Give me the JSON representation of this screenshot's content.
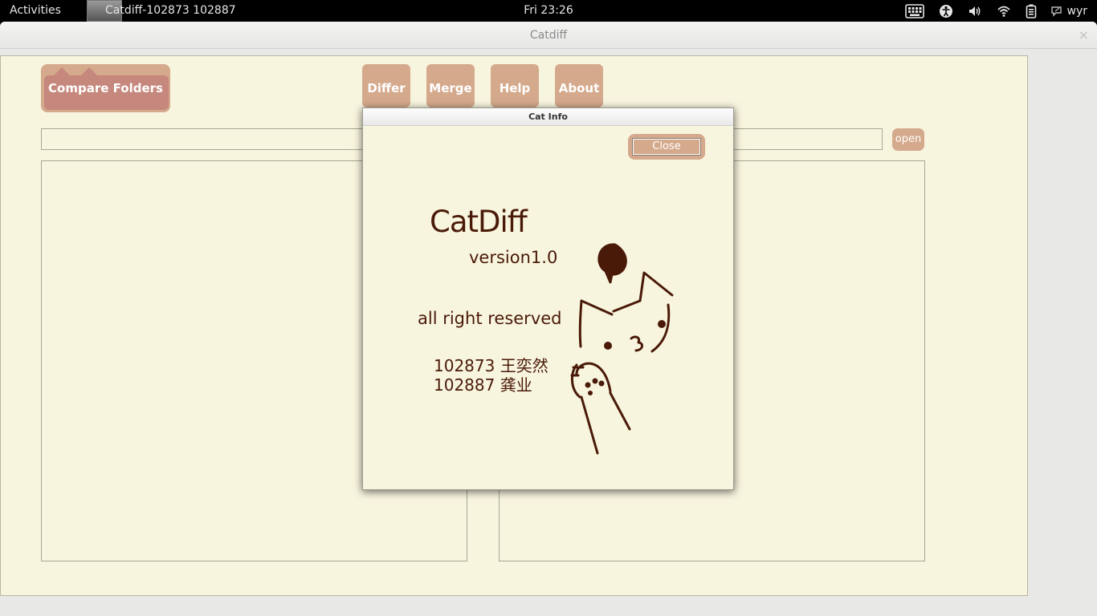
{
  "topbar": {
    "activities": "Activities",
    "app_title": "Catdiff-102873 102887",
    "clock": "Fri 23:26",
    "user": "wyr"
  },
  "window": {
    "title": "Catdiff",
    "close": "×"
  },
  "toolbar": {
    "compare_folders": "Compare Folders",
    "differ": "Differ",
    "merge": "Merge",
    "help": "Help",
    "about": "About"
  },
  "path": {
    "value": "",
    "open": "open"
  },
  "dialog": {
    "title": "Cat Info",
    "close": "Close",
    "app_name": "CatDiff",
    "version": "version1.0",
    "rights": "all right reserved",
    "author1": "102873 王奕然",
    "author2": "102887 龚业"
  },
  "colors": {
    "background": "#f8f5df",
    "button": "#d4a98c",
    "button_active": "#c6877c",
    "text_brown": "#4a1a08"
  }
}
